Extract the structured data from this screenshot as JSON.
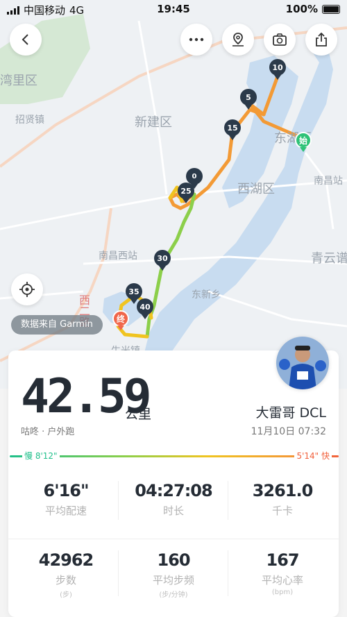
{
  "status_bar": {
    "carrier": "中国移动",
    "network": "4G",
    "time": "19:45",
    "battery": "100%"
  },
  "map": {
    "labels": [
      "湾里区",
      "招贤镇",
      "新建区",
      "东湖区",
      "西湖区",
      "南昌站",
      "南昌西站",
      "青云谱",
      "东新乡",
      "西二路",
      "生米镇",
      "湾里区"
    ],
    "km_markers": [
      "5",
      "10",
      "15",
      "25",
      "30",
      "35",
      "40"
    ],
    "start_label": "始",
    "end_label": "终",
    "source_label": "数据来自 Garmin"
  },
  "summary": {
    "distance": "42.59",
    "unit": "公里",
    "subline": "咕咚 · 户外跑",
    "user_name": "大雷哥 DCL",
    "date": "11月10日 07:32"
  },
  "pace_legend": {
    "slow": "慢 8'12\"",
    "fast": "5'14\" 快"
  },
  "stats": [
    {
      "value": "6'16\"",
      "label": "平均配速",
      "unit": ""
    },
    {
      "value": "04:27:08",
      "label": "时长",
      "unit": ""
    },
    {
      "value": "3261.0",
      "label": "千卡",
      "unit": ""
    },
    {
      "value": "42962",
      "label": "步数",
      "unit": "(步)"
    },
    {
      "value": "160",
      "label": "平均步频",
      "unit": "(步/分钟)"
    },
    {
      "value": "167",
      "label": "平均心率",
      "unit": "(bpm)"
    }
  ],
  "colors": {
    "route_fast": "#f39a35",
    "route_slow": "#8ccf4a",
    "marker": "#2b3a4a",
    "river": "#c8dcf0"
  }
}
